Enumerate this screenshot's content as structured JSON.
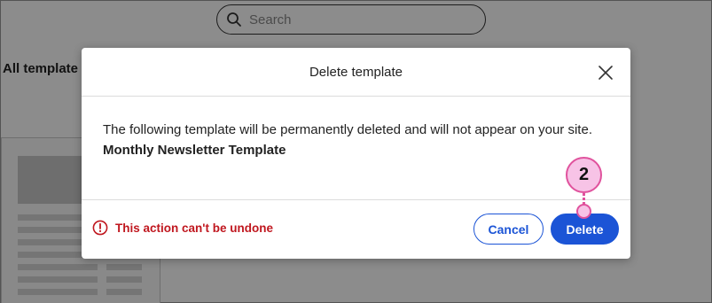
{
  "background": {
    "search_placeholder": "Search",
    "section_heading": "All template"
  },
  "modal": {
    "title": "Delete template",
    "body_text": "The following template will be permanently deleted and will not appear on your site.",
    "template_name": "Monthly Newsletter Template",
    "warning_text": "This action can't be undone",
    "cancel_label": "Cancel",
    "delete_label": "Delete"
  },
  "callout": {
    "step_number": "2"
  },
  "colors": {
    "primary_blue": "#1b54d6",
    "warning_red": "#c0171f",
    "callout_pink": "#e0529d",
    "callout_fill": "#f7c3e6"
  },
  "icons": [
    "search-icon",
    "close-icon",
    "warning-circle-icon"
  ]
}
